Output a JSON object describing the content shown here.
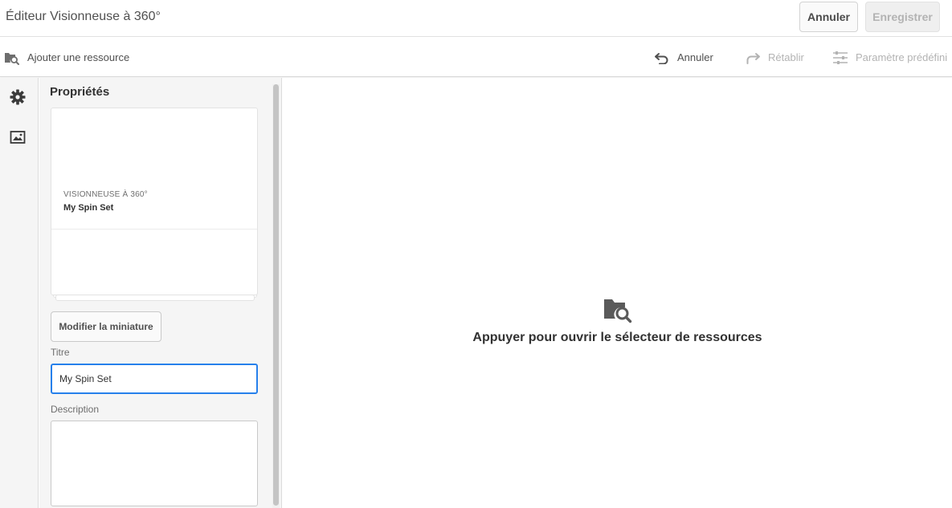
{
  "header": {
    "title": "Éditeur Visionneuse à 360°",
    "cancel_label": "Annuler",
    "save_label": "Enregistrer"
  },
  "actionbar": {
    "add_resource_label": "Ajouter une ressource",
    "undo_label": "Annuler",
    "redo_label": "Rétablir",
    "preset_label": "Paramètre prédéfini"
  },
  "rail": {
    "items": [
      {
        "icon": "gear-icon"
      },
      {
        "icon": "image-icon"
      }
    ]
  },
  "properties": {
    "title": "Propriétés",
    "card": {
      "type_label": "VISIONNEUSE À 360°",
      "name": "My Spin Set"
    },
    "modify_thumbnail_label": "Modifier la miniature",
    "title_field_label": "Titre",
    "title_field_value": "My Spin Set",
    "description_field_label": "Description",
    "description_field_value": ""
  },
  "canvas": {
    "picker_text": "Appuyer pour ouvrir le sélecteur de ressources"
  },
  "colors": {
    "accent": "#2680eb",
    "text": "#4b4b4b",
    "disabled": "#b3b3b3",
    "panel_bg": "#f5f5f5"
  }
}
